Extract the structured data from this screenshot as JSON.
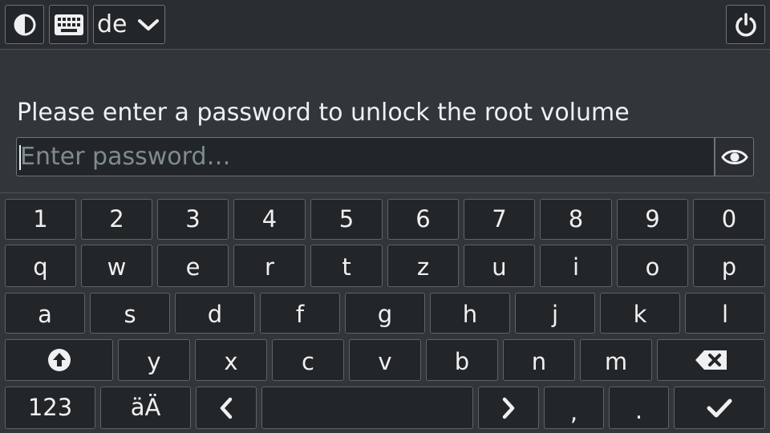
{
  "topbar": {
    "contrast_icon": "contrast-icon",
    "keyboard_icon": "keyboard-icon",
    "language": "de",
    "power_icon": "power-icon"
  },
  "prompt": {
    "message": "Please enter a password to unlock the root volume",
    "password_placeholder": "Enter password…",
    "password_value": "",
    "reveal_icon": "eye-icon"
  },
  "keyboard": {
    "row_numbers": [
      "1",
      "2",
      "3",
      "4",
      "5",
      "6",
      "7",
      "8",
      "9",
      "0"
    ],
    "row_q": [
      "q",
      "w",
      "e",
      "r",
      "t",
      "z",
      "u",
      "i",
      "o",
      "p"
    ],
    "row_a": [
      "a",
      "s",
      "d",
      "f",
      "g",
      "h",
      "j",
      "k",
      "l"
    ],
    "row_y": [
      "y",
      "x",
      "c",
      "v",
      "b",
      "n",
      "m"
    ],
    "shift_icon": "shift-arrow-icon",
    "backspace_icon": "backspace-icon",
    "symbols_label": "123",
    "umlaut_label": "äÄ",
    "left_icon": "chevron-left-icon",
    "space_label": "",
    "right_icon": "chevron-right-icon",
    "comma_label": ",",
    "period_label": ".",
    "enter_icon": "checkmark-icon"
  },
  "colors": {
    "background": "#31363b",
    "topbar": "#2a2e32",
    "key_fill": "#232629",
    "border": "#6e7378",
    "text": "#eff0f1",
    "placeholder": "#7f8c8d"
  }
}
